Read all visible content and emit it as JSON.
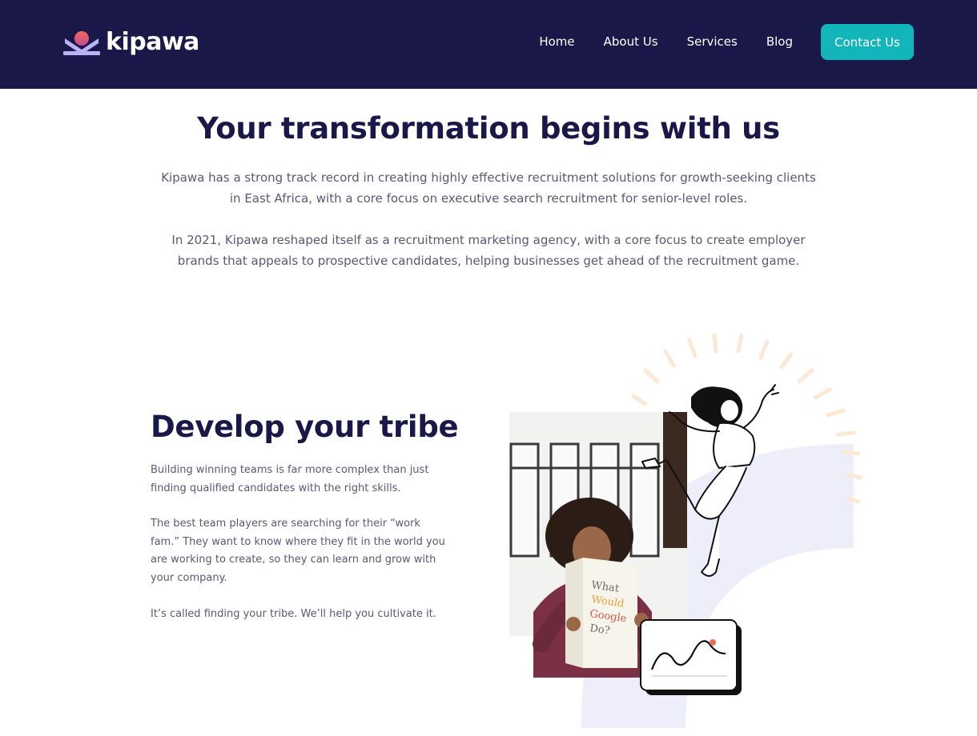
{
  "header": {
    "brand": "kipawa",
    "nav": [
      "Home",
      "About Us",
      "Services",
      "Blog"
    ],
    "cta": "Contact Us",
    "colors": {
      "navy": "#1a1749",
      "teal": "#12b5b9",
      "sun": "#f06a5a",
      "lavender": "#b9b4f5"
    }
  },
  "hero": {
    "title": "Your transformation begins with us",
    "p1": "Kipawa has a strong track record in creating highly effective recruitment solutions for growth-seeking clients in East Africa, with a core focus on executive search recruitment for senior-level roles.",
    "p2": "In 2021, Kipawa reshaped itself as a recruitment marketing agency, with a core focus to create employer brands that appeals to prospective candidates, helping businesses get ahead of the recruitment game."
  },
  "tribe": {
    "title": "Develop your tribe",
    "p1": "Building winning teams is far more complex than just finding qualified candidates with the right skills.",
    "p2": "The best team players are searching for their “work fam.” They want to know where they fit in the world you are working to create, so they can learn and grow with your company.",
    "p3": "It’s called finding your tribe. We’ll help you cultivate it."
  },
  "illustration": {
    "book_title": "What Would Google Do?",
    "icons": [
      "photo-woman-reading",
      "jumping-person-icon",
      "chart-card-icon",
      "sunburst-rays"
    ]
  }
}
